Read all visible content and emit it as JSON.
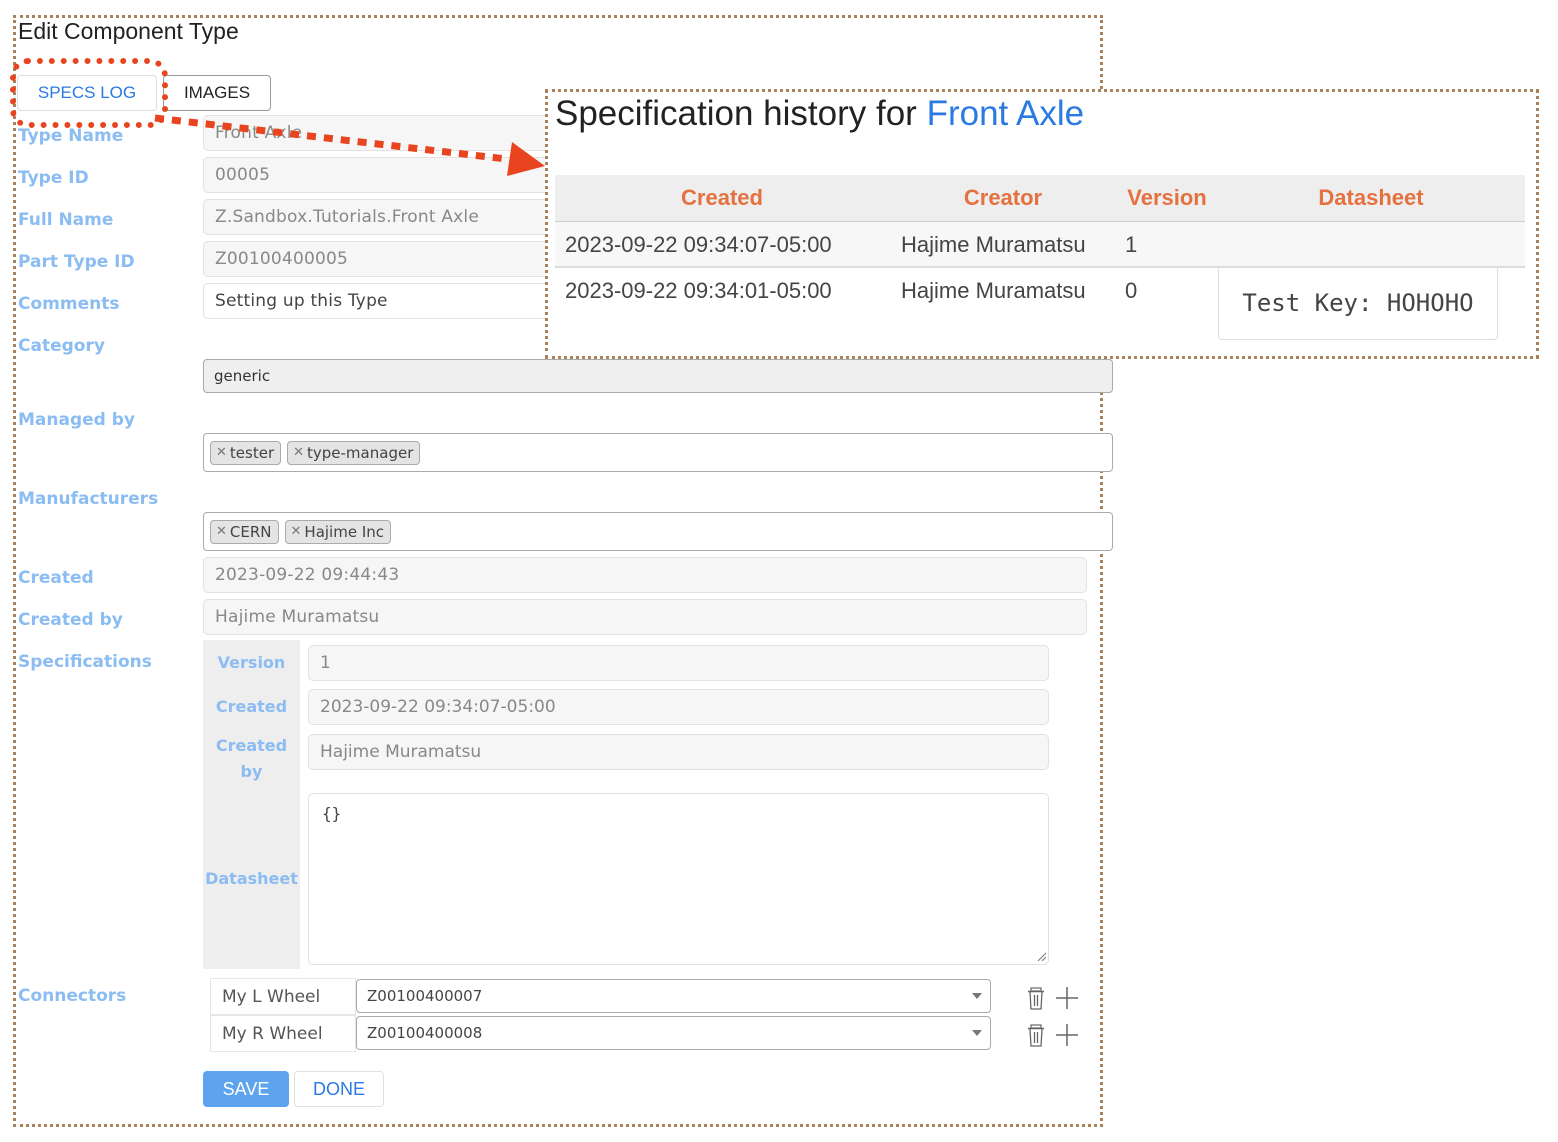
{
  "page": {
    "title": "Edit Component Type"
  },
  "tabs": [
    {
      "label": "SPECS LOG",
      "active": true
    },
    {
      "label": "IMAGES",
      "active": false
    }
  ],
  "form": {
    "type_name": {
      "label": "Type Name",
      "value": "Front Axle"
    },
    "type_id": {
      "label": "Type ID",
      "value": "00005"
    },
    "full_name": {
      "label": "Full Name",
      "value": "Z.Sandbox.Tutorials.Front Axle"
    },
    "part_type_id": {
      "label": "Part Type ID",
      "value": "Z00100400005"
    },
    "comments": {
      "label": "Comments",
      "value": "Setting up this Type"
    },
    "category": {
      "label": "Category",
      "value": "generic"
    },
    "managed_by": {
      "label": "Managed by",
      "tags": [
        "tester",
        "type-manager"
      ]
    },
    "manufacturers": {
      "label": "Manufacturers",
      "tags": [
        "CERN",
        "Hajime Inc"
      ]
    },
    "created": {
      "label": "Created",
      "value": "2023-09-22 09:44:43"
    },
    "created_by": {
      "label": "Created by",
      "value": "Hajime Muramatsu"
    },
    "specifications": {
      "label": "Specifications",
      "version": {
        "label": "Version",
        "value": "1"
      },
      "created": {
        "label": "Created",
        "value": "2023-09-22 09:34:07-05:00"
      },
      "created_by": {
        "label_line1": "Created",
        "label_line2": "by",
        "value": "Hajime Muramatsu"
      },
      "datasheet": {
        "label": "Datasheet",
        "value": "{}"
      }
    },
    "connectors": {
      "label": "Connectors",
      "items": [
        {
          "name": "My L Wheel",
          "value": "Z00100400007"
        },
        {
          "name": "My R Wheel",
          "value": "Z00100400008"
        }
      ]
    },
    "remove_icon": "trash-icon",
    "add_icon": "plus-icon"
  },
  "buttons": {
    "save": "SAVE",
    "done": "DONE"
  },
  "history": {
    "title_prefix": "Specification history for ",
    "title_accent": "Front Axle",
    "columns": [
      "Created",
      "Creator",
      "Version",
      "Datasheet"
    ],
    "rows": [
      {
        "created": "2023-09-22 09:34:07-05:00",
        "creator": "Hajime Muramatsu",
        "version": "1",
        "datasheet": ""
      },
      {
        "created": "2023-09-22 09:34:01-05:00",
        "creator": "Hajime Muramatsu",
        "version": "0",
        "datasheet": "Test Key: HOHOHO"
      }
    ]
  },
  "colors": {
    "accent": "#2a7ae2",
    "label": "#8bbcf2",
    "header_text": "#e4713f",
    "annotation": "#e8441f",
    "frame": "#a88258",
    "save_button": "#5ea3ee"
  }
}
